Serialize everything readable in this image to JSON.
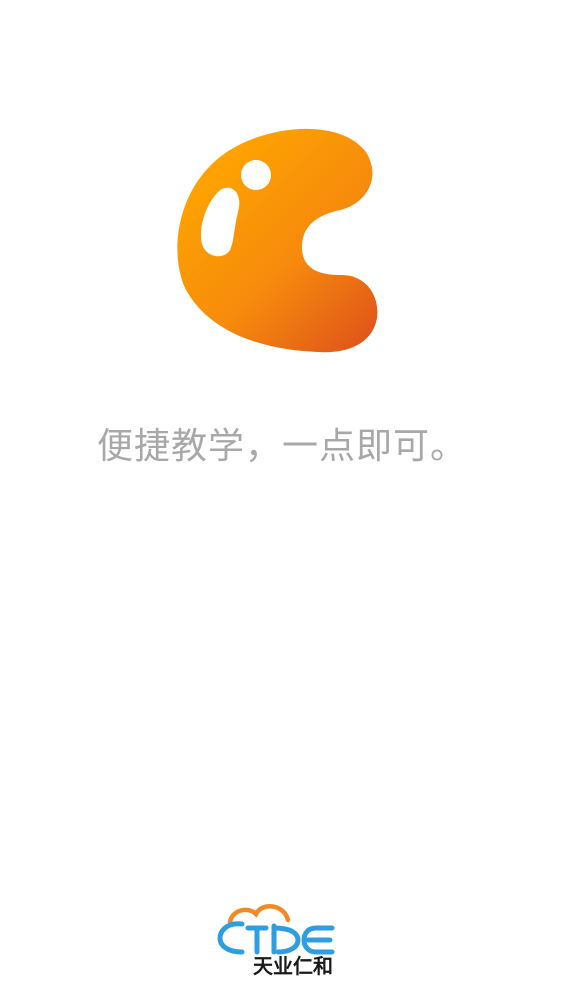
{
  "splash": {
    "tagline": "便捷教学，一点即可。",
    "app_logo_icon": "orange-c-blob-logo",
    "brand": {
      "name": "天业仁和",
      "logo_icon": "cloud-tyrh-logo"
    }
  },
  "colors": {
    "background": "#ffffff",
    "logo_gradient_start": "#ffa000",
    "logo_gradient_end": "#e05518",
    "tagline": "#a8a8a8",
    "brand_orange": "#f08a24",
    "brand_blue": "#2e9ee0",
    "brand_text": "#1a1a1a"
  }
}
